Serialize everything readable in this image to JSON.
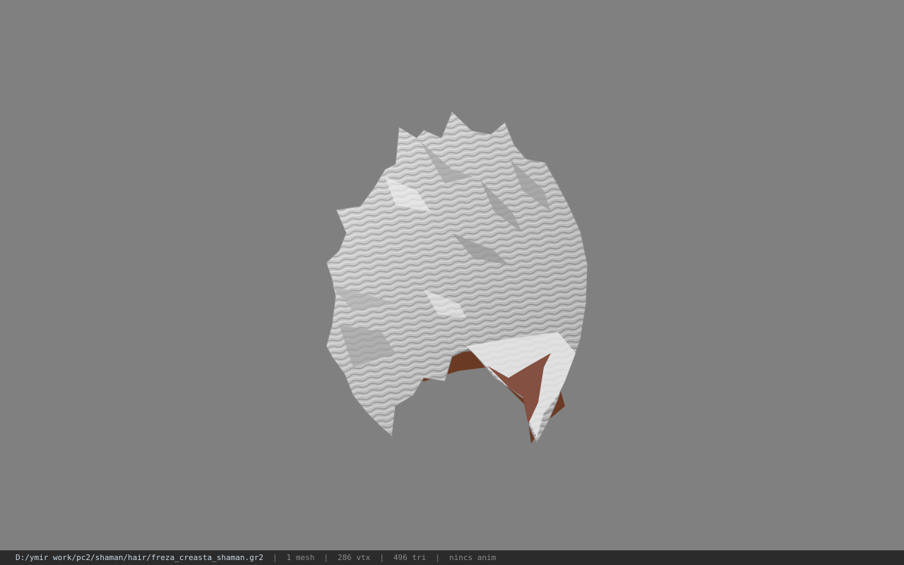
{
  "viewer": {
    "background_color": "#808080",
    "model_icon": "hair-mesh-icon"
  },
  "status": {
    "file_path": "D:/ymir work/pc2/shaman/hair/freza_creasta_shaman.gr2",
    "separator": "|",
    "mesh_count": "1 mesh",
    "vertex_count": "286 vtx",
    "triangle_count": "496 tri",
    "anim_info": "nincs anim"
  }
}
